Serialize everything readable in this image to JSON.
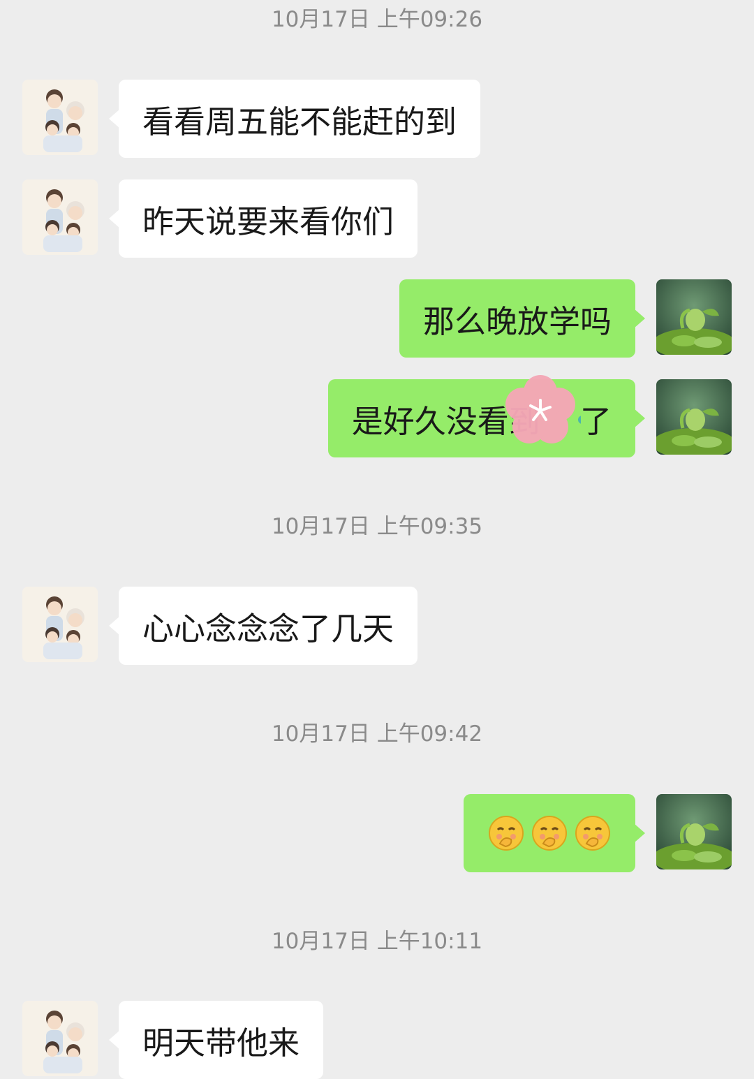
{
  "timestamps": [
    "10月17日 上午09:26",
    "10月17日 上午09:35",
    "10月17日 上午09:42",
    "10月17日 上午10:11"
  ],
  "messages": [
    {
      "side": "in",
      "text": "看看周五能不能赶的到"
    },
    {
      "side": "in",
      "text": "昨天说要来看你们"
    },
    {
      "side": "out",
      "text": "那么晚放学吗"
    },
    {
      "side": "out",
      "text": "是好久没看到    了"
    },
    {
      "side": "in",
      "text": "心心念念念了几天"
    },
    {
      "side": "out",
      "emoji": [
        "shy-face-icon",
        "shy-face-icon",
        "shy-face-icon"
      ]
    },
    {
      "side": "in",
      "text": "明天带他来"
    }
  ],
  "colors": {
    "background": "#ededed",
    "incoming_bubble": "#ffffff",
    "outgoing_bubble": "#95ec69",
    "timestamp": "#8a8a8a"
  }
}
